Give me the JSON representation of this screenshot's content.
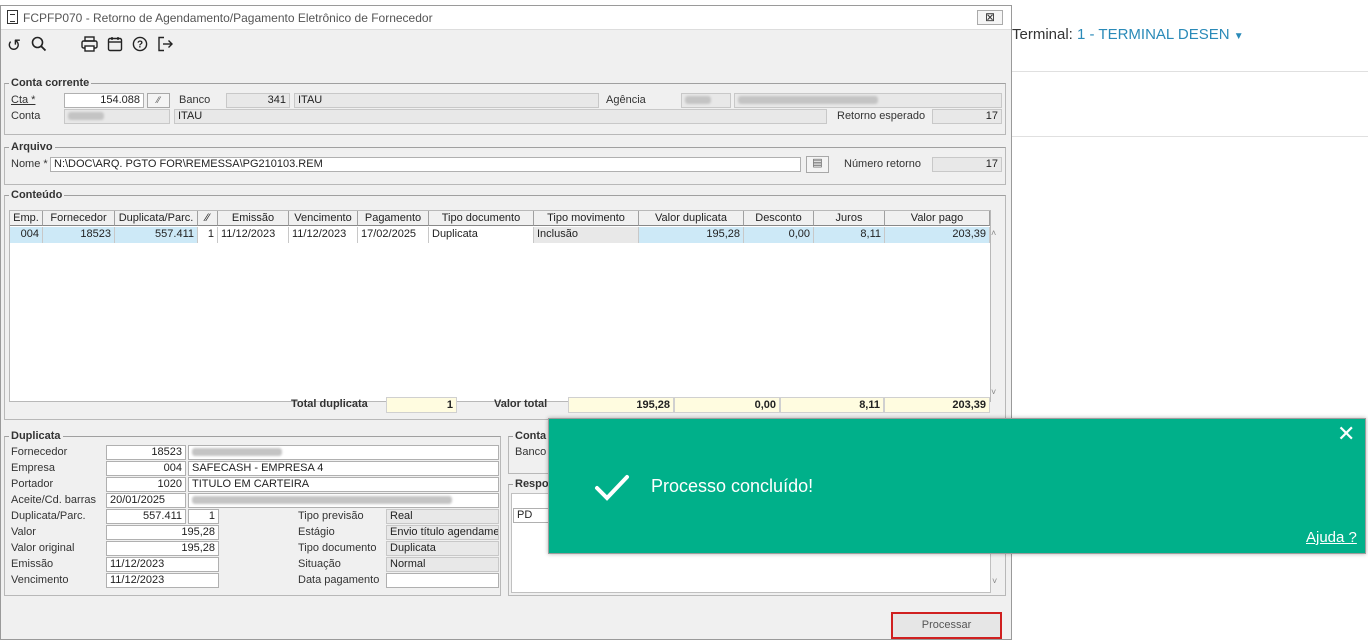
{
  "window": {
    "title": "FCPFP070 - Retorno de Agendamento/Pagamento Eletrônico de Fornecedor",
    "close": "⊠"
  },
  "toolbar": {
    "icons": [
      "refresh-icon",
      "search-icon",
      "print-icon",
      "calendar-icon",
      "help-icon",
      "exit-icon"
    ]
  },
  "conta_corrente": {
    "legend": "Conta corrente",
    "cta_label": "Cta *",
    "cta_value": "154.088",
    "banco_label": "Banco",
    "banco_code": "341",
    "banco_name": "ITAU",
    "agencia_label": "Agência",
    "conta_label": "Conta",
    "conta_name": "ITAU",
    "retorno_label": "Retorno esperado",
    "retorno_value": "17"
  },
  "arquivo": {
    "legend": "Arquivo",
    "nome_label": "Nome *",
    "nome_value": "N:\\DOC\\ARQ. PGTO FOR\\REMESSA\\PG210103.REM",
    "numero_label": "Número retorno",
    "numero_value": "17"
  },
  "conteudo": {
    "legend": "Conteúdo",
    "columns": [
      "Emp.",
      "Fornecedor",
      "Duplicata/Parc.",
      "",
      "Emissão",
      "Vencimento",
      "Pagamento",
      "Tipo documento",
      "Tipo movimento",
      "Valor duplicata",
      "Desconto",
      "Juros",
      "Valor pago"
    ],
    "row": [
      "004",
      "18523",
      "557.411",
      "1",
      "11/12/2023",
      "11/12/2023",
      "17/02/2025",
      "Duplicata",
      "Inclusão",
      "195,28",
      "0,00",
      "8,11",
      "203,39"
    ],
    "total_dup_label": "Total duplicata",
    "total_dup_value": "1",
    "valor_total_label": "Valor total",
    "totals": [
      "195,28",
      "0,00",
      "8,11",
      "203,39"
    ]
  },
  "duplicata": {
    "legend": "Duplicata",
    "fornecedor_label": "Fornecedor",
    "fornecedor_value": "18523",
    "empresa_label": "Empresa",
    "empresa_value": "004",
    "empresa_name": "SAFECASH -  EMPRESA 4",
    "portador_label": "Portador",
    "portador_value": "1020",
    "portador_name": "TITULO EM CARTEIRA",
    "aceite_label": "Aceite/Cd. barras",
    "aceite_value": "20/01/2025",
    "dup_label": "Duplicata/Parc.",
    "dup_value": "557.411",
    "parc_value": "1",
    "valor_label": "Valor",
    "valor_value": "195,28",
    "valor_orig_label": "Valor original",
    "valor_orig_value": "195,28",
    "emissao_label": "Emissão",
    "emissao_value": "11/12/2023",
    "venc_label": "Vencimento",
    "venc_value": "11/12/2023",
    "tipo_prev_label": "Tipo previsão",
    "tipo_prev_value": "Real",
    "estagio_label": "Estágio",
    "estagio_value": "Envio título agendamer",
    "tipo_doc_label": "Tipo documento",
    "tipo_doc_value": "Duplicata",
    "situacao_label": "Situação",
    "situacao_value": "Normal",
    "data_pag_label": "Data pagamento",
    "data_pag_value": ""
  },
  "conta_right": {
    "legend": "Conta",
    "banco_label": "Banco",
    "resp_legend": "Respo",
    "pd_value": "PD"
  },
  "processar": "Processar",
  "terminal": {
    "label": "Terminal:",
    "value": "1 - TERMINAL DESEN"
  },
  "toast": {
    "message": "Processo concluído!",
    "help": "Ajuda ?"
  },
  "colors": {
    "toast_bg": "#00b08a",
    "accent": "#2a8ab8"
  }
}
